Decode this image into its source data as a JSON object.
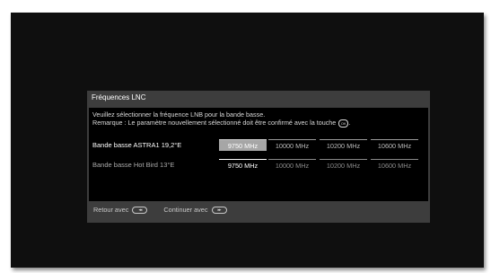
{
  "dialog": {
    "title": "Fréquences LNC",
    "instruction_line1": "Veuillez sélectionner la fréquence LNB pour la bande basse.",
    "instruction_line2": "Remarque : Le paramètre nouvellement sélectionné doit être confirmé avec la touche",
    "ok_key_icon": "ok-key-icon",
    "rows": [
      {
        "label": "Bande basse ASTRA1 19,2°E",
        "options": [
          "9750 MHz",
          "10000 MHz",
          "10200 MHz",
          "10600 MHz"
        ],
        "selected": "9750 MHz"
      },
      {
        "label": "Bande basse Hot Bird 13°E",
        "options": [
          "9750 MHz",
          "10000 MHz",
          "10200 MHz",
          "10600 MHz"
        ],
        "selected": "9750 MHz"
      }
    ],
    "footer": {
      "back_label": "Retour avec",
      "back_icon": "rewind-key-icon",
      "continue_label": "Continuer avec",
      "continue_icon": "fast-forward-key-icon"
    }
  },
  "colors": {
    "screen_bg": "#0f0f0f",
    "dialog_bg": "#3d3d3d",
    "content_bg": "#000000",
    "selected_bg": "#a6a6a6"
  }
}
